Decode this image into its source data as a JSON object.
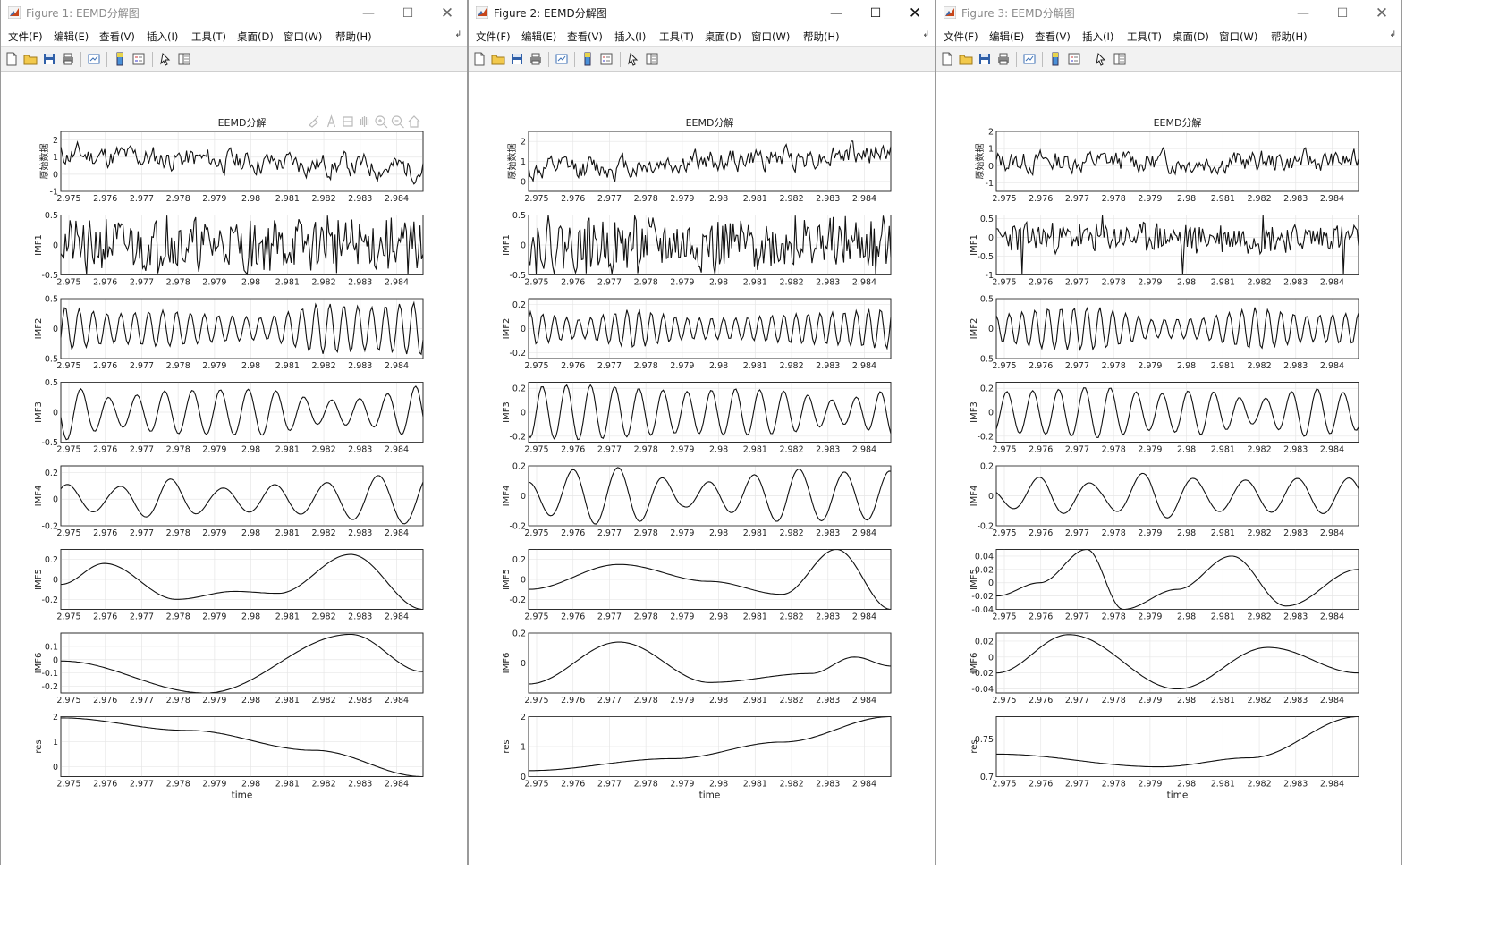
{
  "windows": [
    {
      "title": "Figure 1: EEMD分解图",
      "active": false,
      "plot_title": "EEMD分解",
      "show_axes_toolbar": true,
      "menu": [
        "文件(F)",
        "编辑(E)",
        "查看(V)",
        "插入(I)",
        "工具(T)",
        "桌面(D)",
        "窗口(W)",
        "帮助(H)"
      ],
      "panels": [
        {
          "ylabel": "原始数据",
          "yticks": [
            "2",
            "1",
            "0",
            "-1"
          ],
          "ylim": [
            -1,
            2.5
          ],
          "shape": "noise",
          "amp": 1.4,
          "trend": -1.8,
          "seed": 11
        },
        {
          "ylabel": "IMF1",
          "yticks": [
            "0.5",
            "0",
            "-0.5"
          ],
          "ylim": [
            -0.5,
            0.5
          ],
          "shape": "hf",
          "amp": 0.5,
          "seed": 21
        },
        {
          "ylabel": "IMF2",
          "yticks": [
            "0.5",
            "0",
            "-0.5"
          ],
          "ylim": [
            -0.5,
            0.5
          ],
          "shape": "osc",
          "cycles": 26,
          "amp": 0.5,
          "seed": 31
        },
        {
          "ylabel": "IMF3",
          "yticks": [
            "0.5",
            "0",
            "-0.5"
          ],
          "ylim": [
            -0.5,
            0.5
          ],
          "shape": "osc",
          "cycles": 13,
          "amp": 0.5,
          "seed": 41
        },
        {
          "ylabel": "IMF4",
          "yticks": [
            "0.2",
            "0",
            "-0.2"
          ],
          "ylim": [
            -0.2,
            0.25
          ],
          "shape": "osc",
          "cycles": 7,
          "amp": 0.2,
          "seed": 51
        },
        {
          "ylabel": "IMF5",
          "yticks": [
            "0.2",
            "0",
            "-0.2"
          ],
          "ylim": [
            -0.3,
            0.3
          ],
          "shape": "smooth",
          "pts": [
            [
              0,
              -0.05
            ],
            [
              0.12,
              0.16
            ],
            [
              0.32,
              -0.2
            ],
            [
              0.48,
              -0.12
            ],
            [
              0.6,
              -0.14
            ],
            [
              0.8,
              0.25
            ],
            [
              1,
              -0.3
            ]
          ]
        },
        {
          "ylabel": "IMF6",
          "yticks": [
            "0.1",
            "0",
            "-0.1",
            "-0.2"
          ],
          "ylim": [
            -0.25,
            0.2
          ],
          "shape": "smooth",
          "pts": [
            [
              0,
              -0.01
            ],
            [
              0.4,
              -0.25
            ],
            [
              0.8,
              0.19
            ],
            [
              1,
              -0.09
            ]
          ]
        },
        {
          "ylabel": "res",
          "yticks": [
            "2",
            "1",
            "0"
          ],
          "ylim": [
            -0.4,
            2
          ],
          "shape": "smooth",
          "pts": [
            [
              0,
              1.95
            ],
            [
              0.35,
              1.45
            ],
            [
              0.7,
              0.65
            ],
            [
              1,
              -0.4
            ]
          ]
        }
      ]
    },
    {
      "title": "Figure 2: EEMD分解图",
      "active": true,
      "plot_title": "EEMD分解",
      "show_axes_toolbar": false,
      "menu": [
        "文件(F)",
        "编辑(E)",
        "查看(V)",
        "插入(I)",
        "工具(T)",
        "桌面(D)",
        "窗口(W)",
        "帮助(H)"
      ],
      "panels": [
        {
          "ylabel": "原始数据",
          "yticks": [
            "2",
            "1",
            "0"
          ],
          "ylim": [
            -0.5,
            2.5
          ],
          "shape": "noise",
          "amp": 1.2,
          "trend": 2.2,
          "seed": 12
        },
        {
          "ylabel": "IMF1",
          "yticks": [
            "0.5",
            "0",
            "-0.5"
          ],
          "ylim": [
            -0.5,
            0.5
          ],
          "shape": "hf",
          "amp": 0.5,
          "seed": 22
        },
        {
          "ylabel": "IMF2",
          "yticks": [
            "0.2",
            "0",
            "-0.2"
          ],
          "ylim": [
            -0.25,
            0.25
          ],
          "shape": "osc",
          "cycles": 30,
          "amp": 0.22,
          "seed": 32
        },
        {
          "ylabel": "IMF3",
          "yticks": [
            "0.2",
            "0",
            "-0.2"
          ],
          "ylim": [
            -0.25,
            0.25
          ],
          "shape": "osc",
          "cycles": 15,
          "amp": 0.24,
          "seed": 42
        },
        {
          "ylabel": "IMF4",
          "yticks": [
            "0.2",
            "0",
            "-0.2"
          ],
          "ylim": [
            -0.2,
            0.2
          ],
          "shape": "osc",
          "cycles": 8,
          "amp": 0.2,
          "seed": 52
        },
        {
          "ylabel": "IMF5",
          "yticks": [
            "0.2",
            "0",
            "-0.2"
          ],
          "ylim": [
            -0.3,
            0.3
          ],
          "shape": "smooth",
          "pts": [
            [
              0,
              -0.1
            ],
            [
              0.25,
              0.15
            ],
            [
              0.5,
              -0.02
            ],
            [
              0.7,
              -0.15
            ],
            [
              0.85,
              0.3
            ],
            [
              1,
              -0.3
            ]
          ]
        },
        {
          "ylabel": "IMF6",
          "yticks": [
            "0.2",
            "0"
          ],
          "ylim": [
            -0.2,
            0.2
          ],
          "shape": "smooth",
          "pts": [
            [
              0,
              -0.14
            ],
            [
              0.25,
              0.14
            ],
            [
              0.5,
              -0.13
            ],
            [
              0.78,
              -0.07
            ],
            [
              0.9,
              0.04
            ],
            [
              1,
              -0.02
            ]
          ]
        },
        {
          "ylabel": "res",
          "yticks": [
            "2",
            "1",
            "0"
          ],
          "ylim": [
            0,
            2
          ],
          "shape": "smooth",
          "pts": [
            [
              0,
              0.2
            ],
            [
              0.4,
              0.6
            ],
            [
              0.7,
              1.15
            ],
            [
              1,
              2
            ]
          ]
        }
      ]
    },
    {
      "title": "Figure 3: EEMD分解图",
      "active": false,
      "plot_title": "EEMD分解",
      "show_axes_toolbar": false,
      "menu": [
        "文件(F)",
        "编辑(E)",
        "查看(V)",
        "插入(I)",
        "工具(T)",
        "桌面(D)",
        "窗口(W)",
        "帮助(H)"
      ],
      "panels": [
        {
          "ylabel": "原始数据",
          "yticks": [
            "2",
            "1",
            "0",
            "-1"
          ],
          "ylim": [
            -1.5,
            2
          ],
          "shape": "noise",
          "amp": 1.3,
          "trend": 0,
          "seed": 13
        },
        {
          "ylabel": "IMF1",
          "yticks": [
            "0.5",
            "0",
            "-0.5",
            "-1"
          ],
          "ylim": [
            -1,
            0.6
          ],
          "shape": "hf",
          "amp": 0.45,
          "seed": 23
        },
        {
          "ylabel": "IMF2",
          "yticks": [
            "0.5",
            "0",
            "-0.5"
          ],
          "ylim": [
            -0.5,
            0.5
          ],
          "shape": "osc",
          "cycles": 28,
          "amp": 0.4,
          "seed": 33
        },
        {
          "ylabel": "IMF3",
          "yticks": [
            "0.2",
            "0",
            "-0.2"
          ],
          "ylim": [
            -0.25,
            0.25
          ],
          "shape": "osc",
          "cycles": 14,
          "amp": 0.22,
          "seed": 43
        },
        {
          "ylabel": "IMF4",
          "yticks": [
            "0.2",
            "0",
            "-0.2"
          ],
          "ylim": [
            -0.2,
            0.2
          ],
          "shape": "osc",
          "cycles": 7,
          "amp": 0.17,
          "seed": 53
        },
        {
          "ylabel": "IMF5",
          "yticks": [
            "0.04",
            "0.02",
            "0",
            "-0.02",
            "-0.04"
          ],
          "ylim": [
            -0.04,
            0.05
          ],
          "shape": "smooth",
          "pts": [
            [
              0,
              -0.02
            ],
            [
              0.12,
              0.0
            ],
            [
              0.25,
              0.05
            ],
            [
              0.35,
              -0.04
            ],
            [
              0.5,
              -0.01
            ],
            [
              0.65,
              0.04
            ],
            [
              0.8,
              -0.035
            ],
            [
              1,
              0.02
            ]
          ]
        },
        {
          "ylabel": "IMF6",
          "yticks": [
            "0.02",
            "0",
            "-0.02",
            "-0.04"
          ],
          "ylim": [
            -0.045,
            0.03
          ],
          "shape": "smooth",
          "pts": [
            [
              0,
              -0.02
            ],
            [
              0.2,
              0.028
            ],
            [
              0.5,
              -0.04
            ],
            [
              0.75,
              0.012
            ],
            [
              1,
              -0.02
            ]
          ]
        },
        {
          "ylabel": "res",
          "yticks": [
            "0.75",
            "0.7"
          ],
          "ylim": [
            0.7,
            0.78
          ],
          "shape": "smooth",
          "pts": [
            [
              0,
              0.73
            ],
            [
              0.45,
              0.713
            ],
            [
              0.7,
              0.725
            ],
            [
              1,
              0.78
            ]
          ]
        }
      ]
    }
  ],
  "xticks": [
    "2.975",
    "2.976",
    "2.977",
    "2.978",
    "2.979",
    "2.98",
    "2.981",
    "2.982",
    "2.983",
    "2.984"
  ],
  "xlabel": "time"
}
